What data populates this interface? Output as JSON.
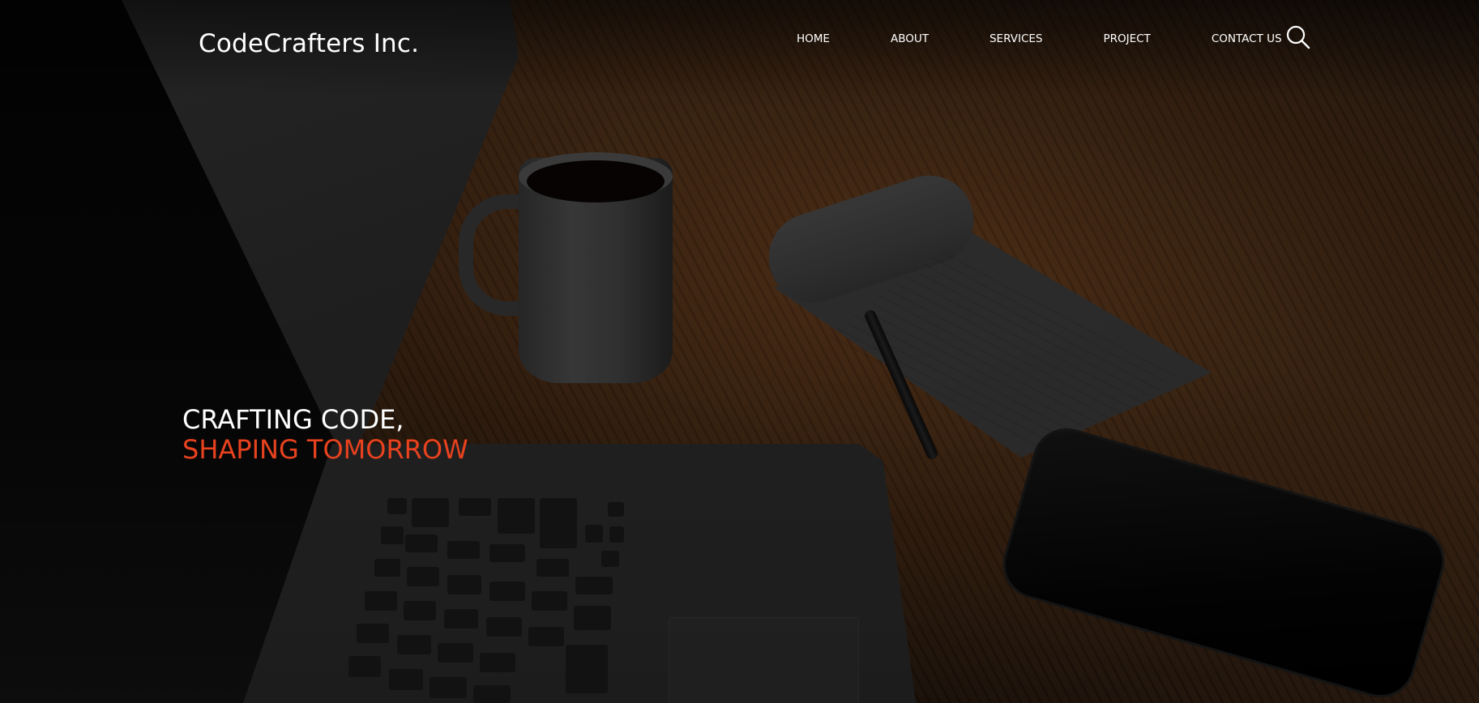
{
  "brand": {
    "name": "CodeCrafters Inc."
  },
  "nav": {
    "items": [
      {
        "label": "HOME"
      },
      {
        "label": "ABOUT"
      },
      {
        "label": "SERVICES"
      },
      {
        "label": "PROJECT"
      },
      {
        "label": "CONTACT US"
      }
    ],
    "search_icon": "search-icon"
  },
  "hero": {
    "line1": "CRAFTING CODE,",
    "line2": "SHAPING TOMORROW",
    "accent_color": "#e8421f",
    "text_color": "#ffffff"
  }
}
